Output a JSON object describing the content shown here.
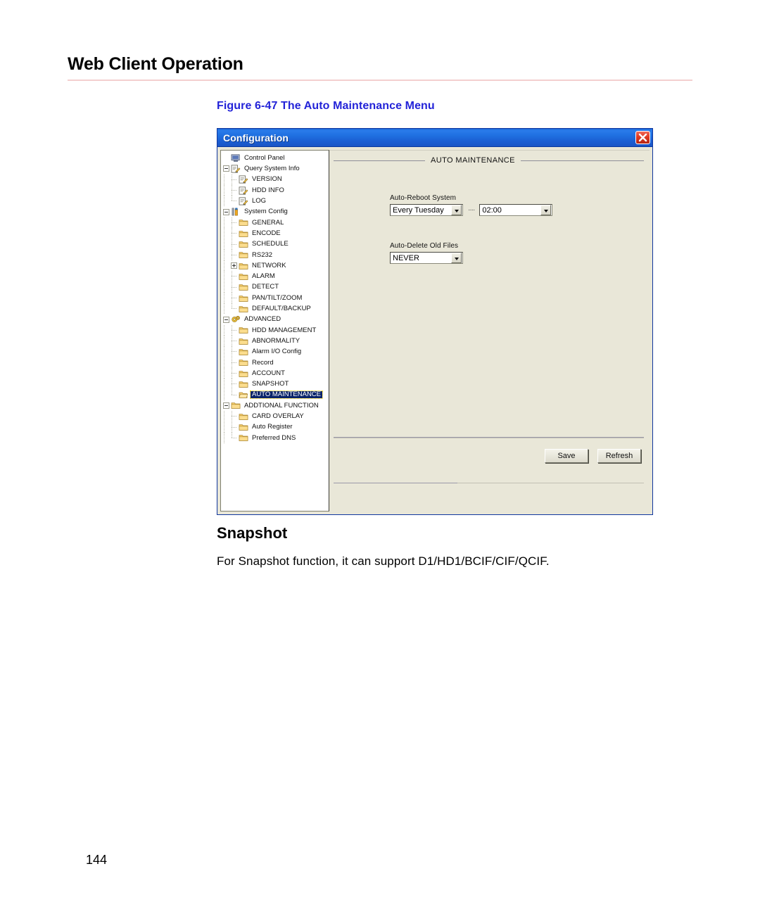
{
  "document": {
    "header_title": "Web Client Operation",
    "figure_caption": "Figure 6-47 The Auto Maintenance Menu",
    "section_title": "Snapshot",
    "body_text": "For Snapshot function, it can support D1/HD1/BCIF/CIF/QCIF.",
    "page_number": "144"
  },
  "dialog": {
    "title": "Configuration",
    "close_icon": "close-icon",
    "tree": [
      {
        "label": "Control Panel",
        "depth": 0,
        "icon": "monitor-icon",
        "twisty": "none",
        "selected": false
      },
      {
        "label": "Query System Info",
        "depth": 0,
        "icon": "notepad-icon",
        "twisty": "minus",
        "selected": false
      },
      {
        "label": "VERSION",
        "depth": 1,
        "icon": "notepad-icon",
        "twisty": "none",
        "selected": false
      },
      {
        "label": "HDD INFO",
        "depth": 1,
        "icon": "notepad-icon",
        "twisty": "none",
        "selected": false
      },
      {
        "label": "LOG",
        "depth": 1,
        "icon": "notepad-icon",
        "twisty": "none",
        "selected": false
      },
      {
        "label": "System Config",
        "depth": 0,
        "icon": "tools-icon",
        "twisty": "minus",
        "selected": false
      },
      {
        "label": "GENERAL",
        "depth": 1,
        "icon": "folder-icon",
        "twisty": "none",
        "selected": false
      },
      {
        "label": "ENCODE",
        "depth": 1,
        "icon": "folder-icon",
        "twisty": "none",
        "selected": false
      },
      {
        "label": "SCHEDULE",
        "depth": 1,
        "icon": "folder-icon",
        "twisty": "none",
        "selected": false
      },
      {
        "label": "RS232",
        "depth": 1,
        "icon": "folder-icon",
        "twisty": "none",
        "selected": false
      },
      {
        "label": "NETWORK",
        "depth": 1,
        "icon": "folder-icon",
        "twisty": "plus",
        "selected": false
      },
      {
        "label": "ALARM",
        "depth": 1,
        "icon": "folder-icon",
        "twisty": "none",
        "selected": false
      },
      {
        "label": "DETECT",
        "depth": 1,
        "icon": "folder-icon",
        "twisty": "none",
        "selected": false
      },
      {
        "label": "PAN/TILT/ZOOM",
        "depth": 1,
        "icon": "folder-icon",
        "twisty": "none",
        "selected": false
      },
      {
        "label": "DEFAULT/BACKUP",
        "depth": 1,
        "icon": "folder-icon",
        "twisty": "none",
        "selected": false
      },
      {
        "label": "ADVANCED",
        "depth": 0,
        "icon": "gears-icon",
        "twisty": "minus",
        "selected": false
      },
      {
        "label": "HDD MANAGEMENT",
        "depth": 1,
        "icon": "folder-icon",
        "twisty": "none",
        "selected": false
      },
      {
        "label": "ABNORMALITY",
        "depth": 1,
        "icon": "folder-icon",
        "twisty": "none",
        "selected": false
      },
      {
        "label": "Alarm I/O Config",
        "depth": 1,
        "icon": "folder-icon",
        "twisty": "none",
        "selected": false
      },
      {
        "label": "Record",
        "depth": 1,
        "icon": "folder-icon",
        "twisty": "none",
        "selected": false
      },
      {
        "label": "ACCOUNT",
        "depth": 1,
        "icon": "folder-icon",
        "twisty": "none",
        "selected": false
      },
      {
        "label": "SNAPSHOT",
        "depth": 1,
        "icon": "folder-icon",
        "twisty": "none",
        "selected": false
      },
      {
        "label": "AUTO MAINTENANCE",
        "depth": 1,
        "icon": "folder-open-icon",
        "twisty": "none",
        "selected": true
      },
      {
        "label": "ADDTIONAL FUNCTION",
        "depth": 0,
        "icon": "folder-icon",
        "twisty": "minus",
        "selected": false
      },
      {
        "label": "CARD OVERLAY",
        "depth": 1,
        "icon": "folder-icon",
        "twisty": "none",
        "selected": false
      },
      {
        "label": "Auto Register",
        "depth": 1,
        "icon": "folder-icon",
        "twisty": "none",
        "selected": false
      },
      {
        "label": "Preferred DNS",
        "depth": 1,
        "icon": "folder-icon",
        "twisty": "none",
        "selected": false
      }
    ],
    "panel": {
      "group_title": "AUTO MAINTENANCE",
      "auto_reboot": {
        "label": "Auto-Reboot System",
        "day_value": "Every Tuesday",
        "separator": "····",
        "time_value": "02:00"
      },
      "auto_delete": {
        "label": "Auto-Delete Old Files",
        "value": "NEVER"
      },
      "buttons": {
        "save_label": "Save",
        "refresh_label": "Refresh"
      }
    }
  },
  "colors": {
    "titlebar_blue": "#1f6fe0",
    "panel_beige": "#e9e7d8",
    "caption_blue": "#2323d8",
    "selection_blue": "#0a246a",
    "header_rule": "#f3cfcf"
  }
}
